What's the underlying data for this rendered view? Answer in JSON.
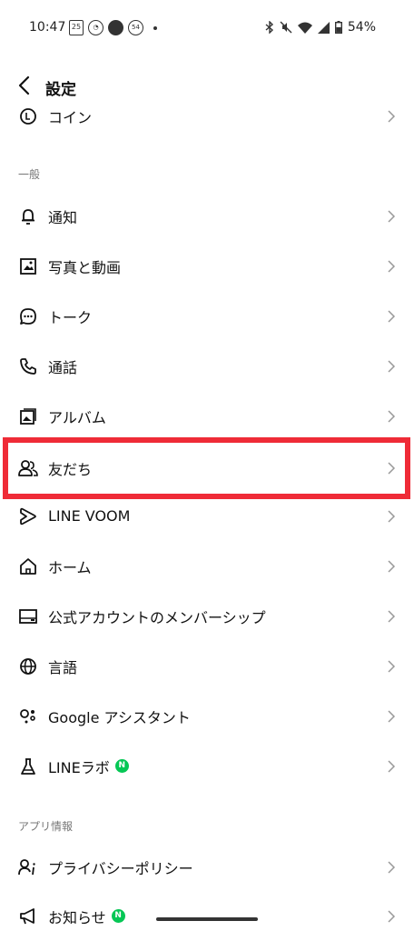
{
  "status_bar": {
    "time": "10:47",
    "calendar_day": "25",
    "ring_value": "54",
    "battery_text": "54%"
  },
  "header": {
    "title": "設定"
  },
  "rows_top": [
    {
      "label": "コイン",
      "icon": "coin-icon"
    }
  ],
  "section_general": "一般",
  "rows_general": [
    {
      "label": "通知",
      "icon": "bell-icon"
    },
    {
      "label": "写真と動画",
      "icon": "image-icon"
    },
    {
      "label": "トーク",
      "icon": "chat-bubble-icon"
    },
    {
      "label": "通話",
      "icon": "phone-icon"
    },
    {
      "label": "アルバム",
      "icon": "album-icon"
    },
    {
      "label": "友だち",
      "icon": "friends-icon"
    },
    {
      "label": "LINE VOOM",
      "icon": "voom-icon"
    },
    {
      "label": "ホーム",
      "icon": "home-icon"
    },
    {
      "label": "公式アカウントのメンバーシップ",
      "icon": "membership-card-icon"
    },
    {
      "label": "言語",
      "icon": "globe-icon"
    },
    {
      "label": "Google アシスタント",
      "icon": "assistant-icon"
    },
    {
      "label": "LINEラボ",
      "icon": "flask-icon",
      "badge": "N"
    }
  ],
  "section_app_info": "アプリ情報",
  "rows_app_info": [
    {
      "label": "プライバシーポリシー",
      "icon": "privacy-icon"
    },
    {
      "label": "お知らせ",
      "icon": "megaphone-icon",
      "badge": "N"
    }
  ],
  "colors": {
    "highlight": "#ef2b37",
    "badge": "#06c755"
  },
  "highlighted_item": "友だち"
}
